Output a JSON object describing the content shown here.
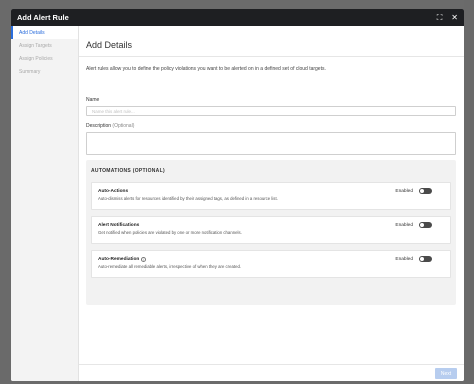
{
  "modal": {
    "title": "Add Alert Rule"
  },
  "header_icons": {
    "expand": "expand-icon",
    "close": "close-icon"
  },
  "steps": [
    {
      "label": "Add Details",
      "active": true
    },
    {
      "label": "Assign Targets",
      "active": false
    },
    {
      "label": "Assign Policies",
      "active": false
    },
    {
      "label": "Summary",
      "active": false
    }
  ],
  "main": {
    "title": "Add Details",
    "intro": "Alert rules allow you to define the policy violations you want to be alerted on in a defined set of cloud targets.",
    "name_label": "Name",
    "name_placeholder": "Name this alert rule...",
    "name_value": "",
    "description_label": "Description",
    "description_optional": "(Optional)",
    "description_value": ""
  },
  "automations": {
    "title": "AUTOMATIONS (OPTIONAL)",
    "items": [
      {
        "title": "Auto-Actions",
        "description": "Auto-dismiss alerts for resources identified by their assigned tags, as defined in a resource list.",
        "enabled_label": "Enabled",
        "has_info": false,
        "enabled": false
      },
      {
        "title": "Alert Notifications",
        "description": "Get notified when policies are violated by one or more notification channels.",
        "enabled_label": "Enabled",
        "has_info": false,
        "enabled": false
      },
      {
        "title": "Auto-Remediation",
        "description": "Auto-remediate all remediable alerts, irrespective of when they are created.",
        "enabled_label": "Enabled",
        "has_info": true,
        "enabled": false
      }
    ]
  },
  "footer": {
    "next_label": "Next"
  },
  "colors": {
    "header_bg": "#1e1f22",
    "accent": "#2a6ddc",
    "next_disabled": "#b7cdef",
    "backdrop": "#6b6b6b"
  }
}
